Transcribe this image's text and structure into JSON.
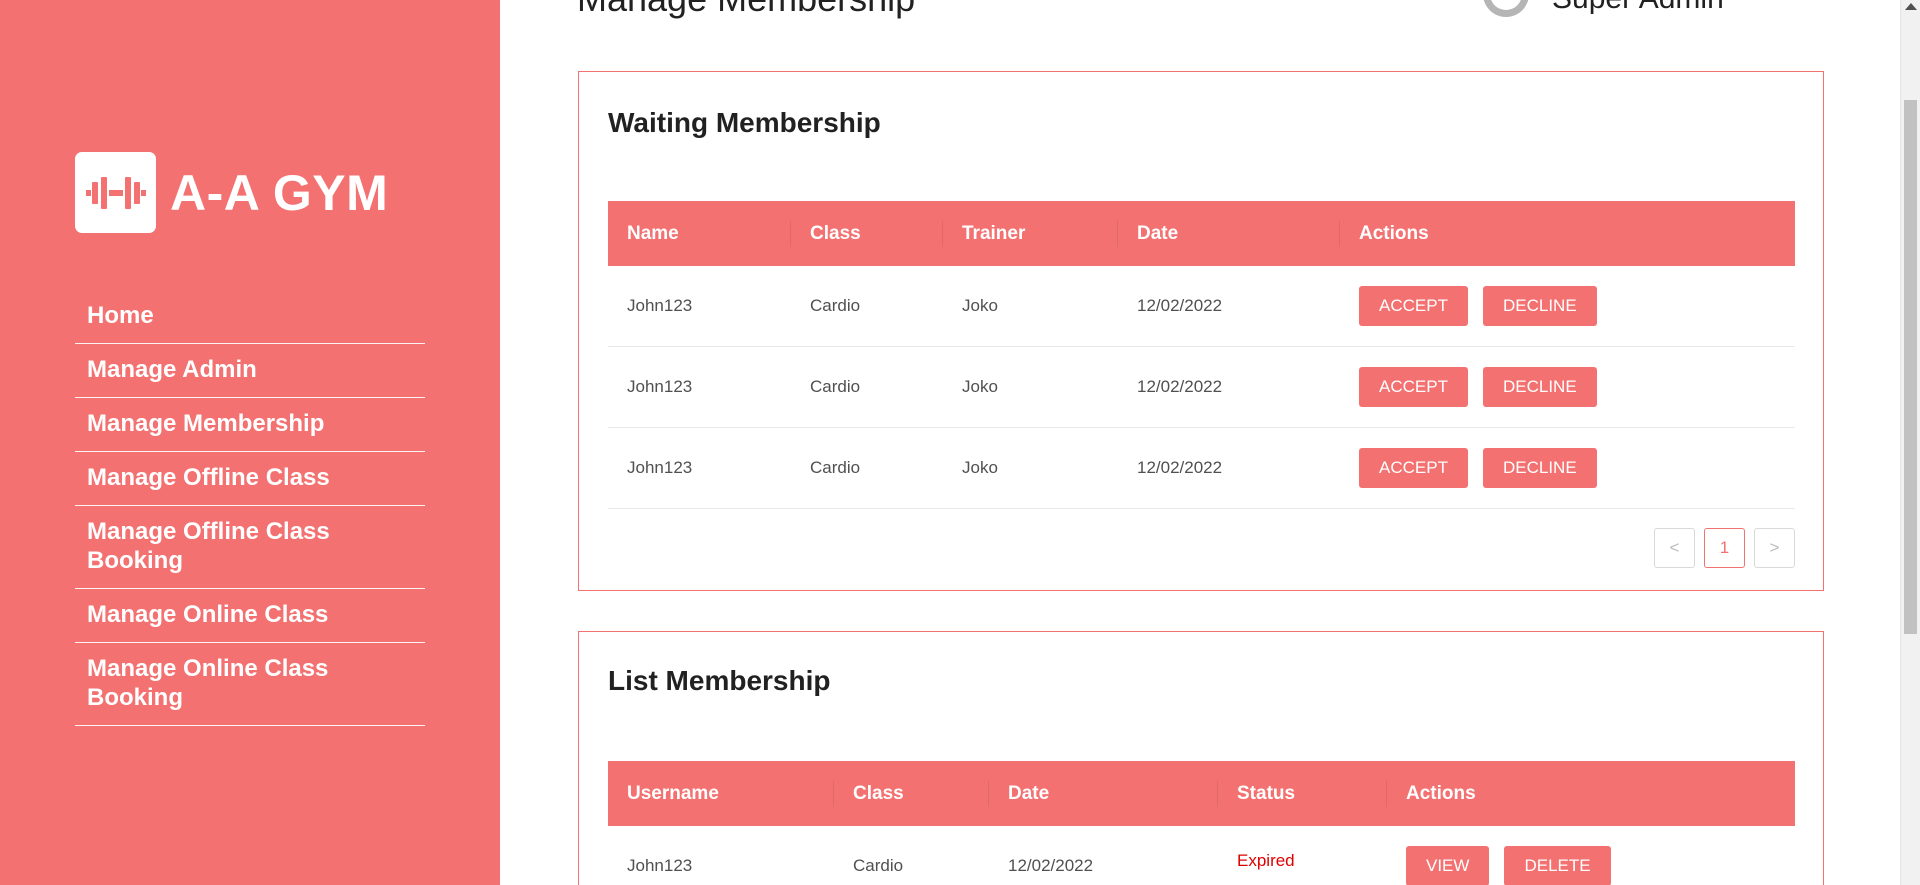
{
  "brand": {
    "name": "A-A GYM",
    "logo_icon": "dumbbell-icon"
  },
  "sidebar": {
    "items": [
      {
        "label": "Home"
      },
      {
        "label": "Manage Admin"
      },
      {
        "label": "Manage Membership"
      },
      {
        "label": "Manage Offline Class"
      },
      {
        "label": "Manage Offline Class Booking"
      },
      {
        "label": "Manage Online Class"
      },
      {
        "label": "Manage Online Class Booking"
      }
    ]
  },
  "header": {
    "title": "Manage Membership",
    "user_name": "Super Admin",
    "user_icon": "user-avatar-icon"
  },
  "waiting": {
    "title": "Waiting Membership",
    "columns": [
      "Name",
      "Class",
      "Trainer",
      "Date",
      "Actions"
    ],
    "rows": [
      {
        "name": "John123",
        "class": "Cardio",
        "trainer": "Joko",
        "date": "12/02/2022"
      },
      {
        "name": "John123",
        "class": "Cardio",
        "trainer": "Joko",
        "date": "12/02/2022"
      },
      {
        "name": "John123",
        "class": "Cardio",
        "trainer": "Joko",
        "date": "12/02/2022"
      }
    ],
    "accept_label": "ACCEPT",
    "decline_label": "DECLINE",
    "pagination": {
      "prev": "<",
      "current": "1",
      "next": ">"
    }
  },
  "list": {
    "title": "List Membership",
    "columns": [
      "Username",
      "Class",
      "Date",
      "Status",
      "Actions"
    ],
    "rows": [
      {
        "username": "John123",
        "class": "Cardio",
        "date": "12/02/2022",
        "status": "Expired"
      }
    ],
    "view_label": "VIEW",
    "delete_label": "DELETE"
  },
  "colors": {
    "accent": "#f37171",
    "expired": "#e00000"
  }
}
